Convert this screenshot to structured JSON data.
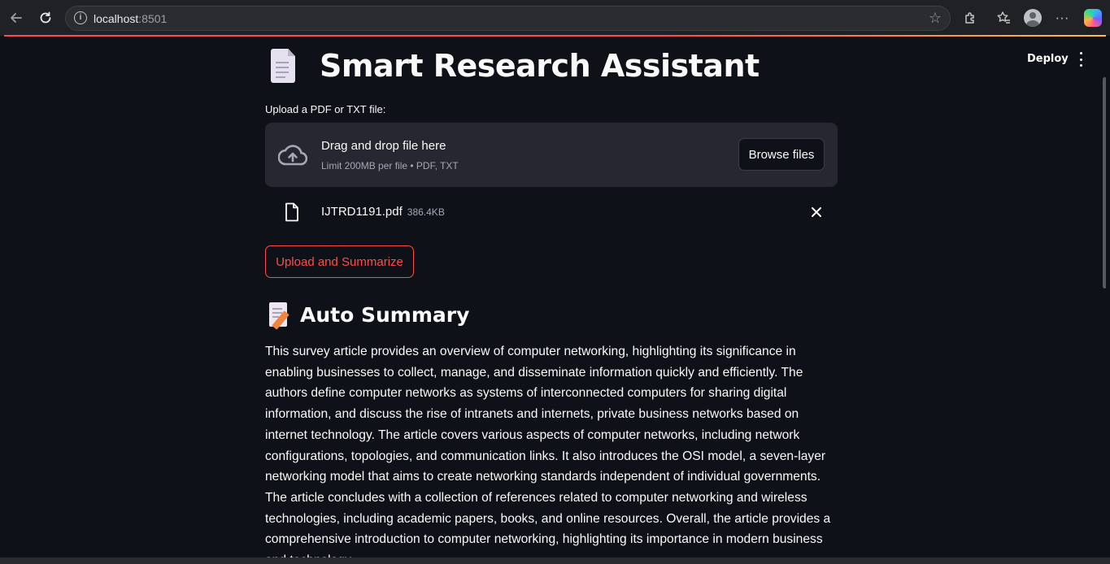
{
  "browser": {
    "url_host": "localhost",
    "url_port": ":8501"
  },
  "header": {
    "deploy_label": "Deploy"
  },
  "page": {
    "title": "Smart Research Assistant",
    "title_icon": "page-facing-up-icon"
  },
  "uploader": {
    "label": "Upload a PDF or TXT file:",
    "drop_title": "Drag and drop file here",
    "drop_subtitle": "Limit 200MB per file • PDF, TXT",
    "browse_label": "Browse files",
    "file": {
      "name": "IJTRD1191.pdf",
      "size": "386.4KB"
    }
  },
  "actions": {
    "summarize_label": "Upload and Summarize"
  },
  "summary": {
    "heading": "Auto Summary",
    "heading_icon": "memo-icon",
    "text": "This survey article provides an overview of computer networking, highlighting its significance in enabling businesses to collect, manage, and disseminate information quickly and efficiently. The authors define computer networks as systems of interconnected computers for sharing digital information, and discuss the rise of intranets and internets, private business networks based on internet technology. The article covers various aspects of computer networks, including network configurations, topologies, and communication links. It also introduces the OSI model, a seven-layer networking model that aims to create networking standards independent of individual governments. The article concludes with a collection of references related to computer networking and wireless technologies, including academic papers, books, and online resources. Overall, the article provides a comprehensive introduction to computer networking, highlighting its importance in modern business and technology."
  },
  "colors": {
    "background": "#0e1117",
    "accent": "#ff4b4b",
    "dropzone": "#262730"
  }
}
